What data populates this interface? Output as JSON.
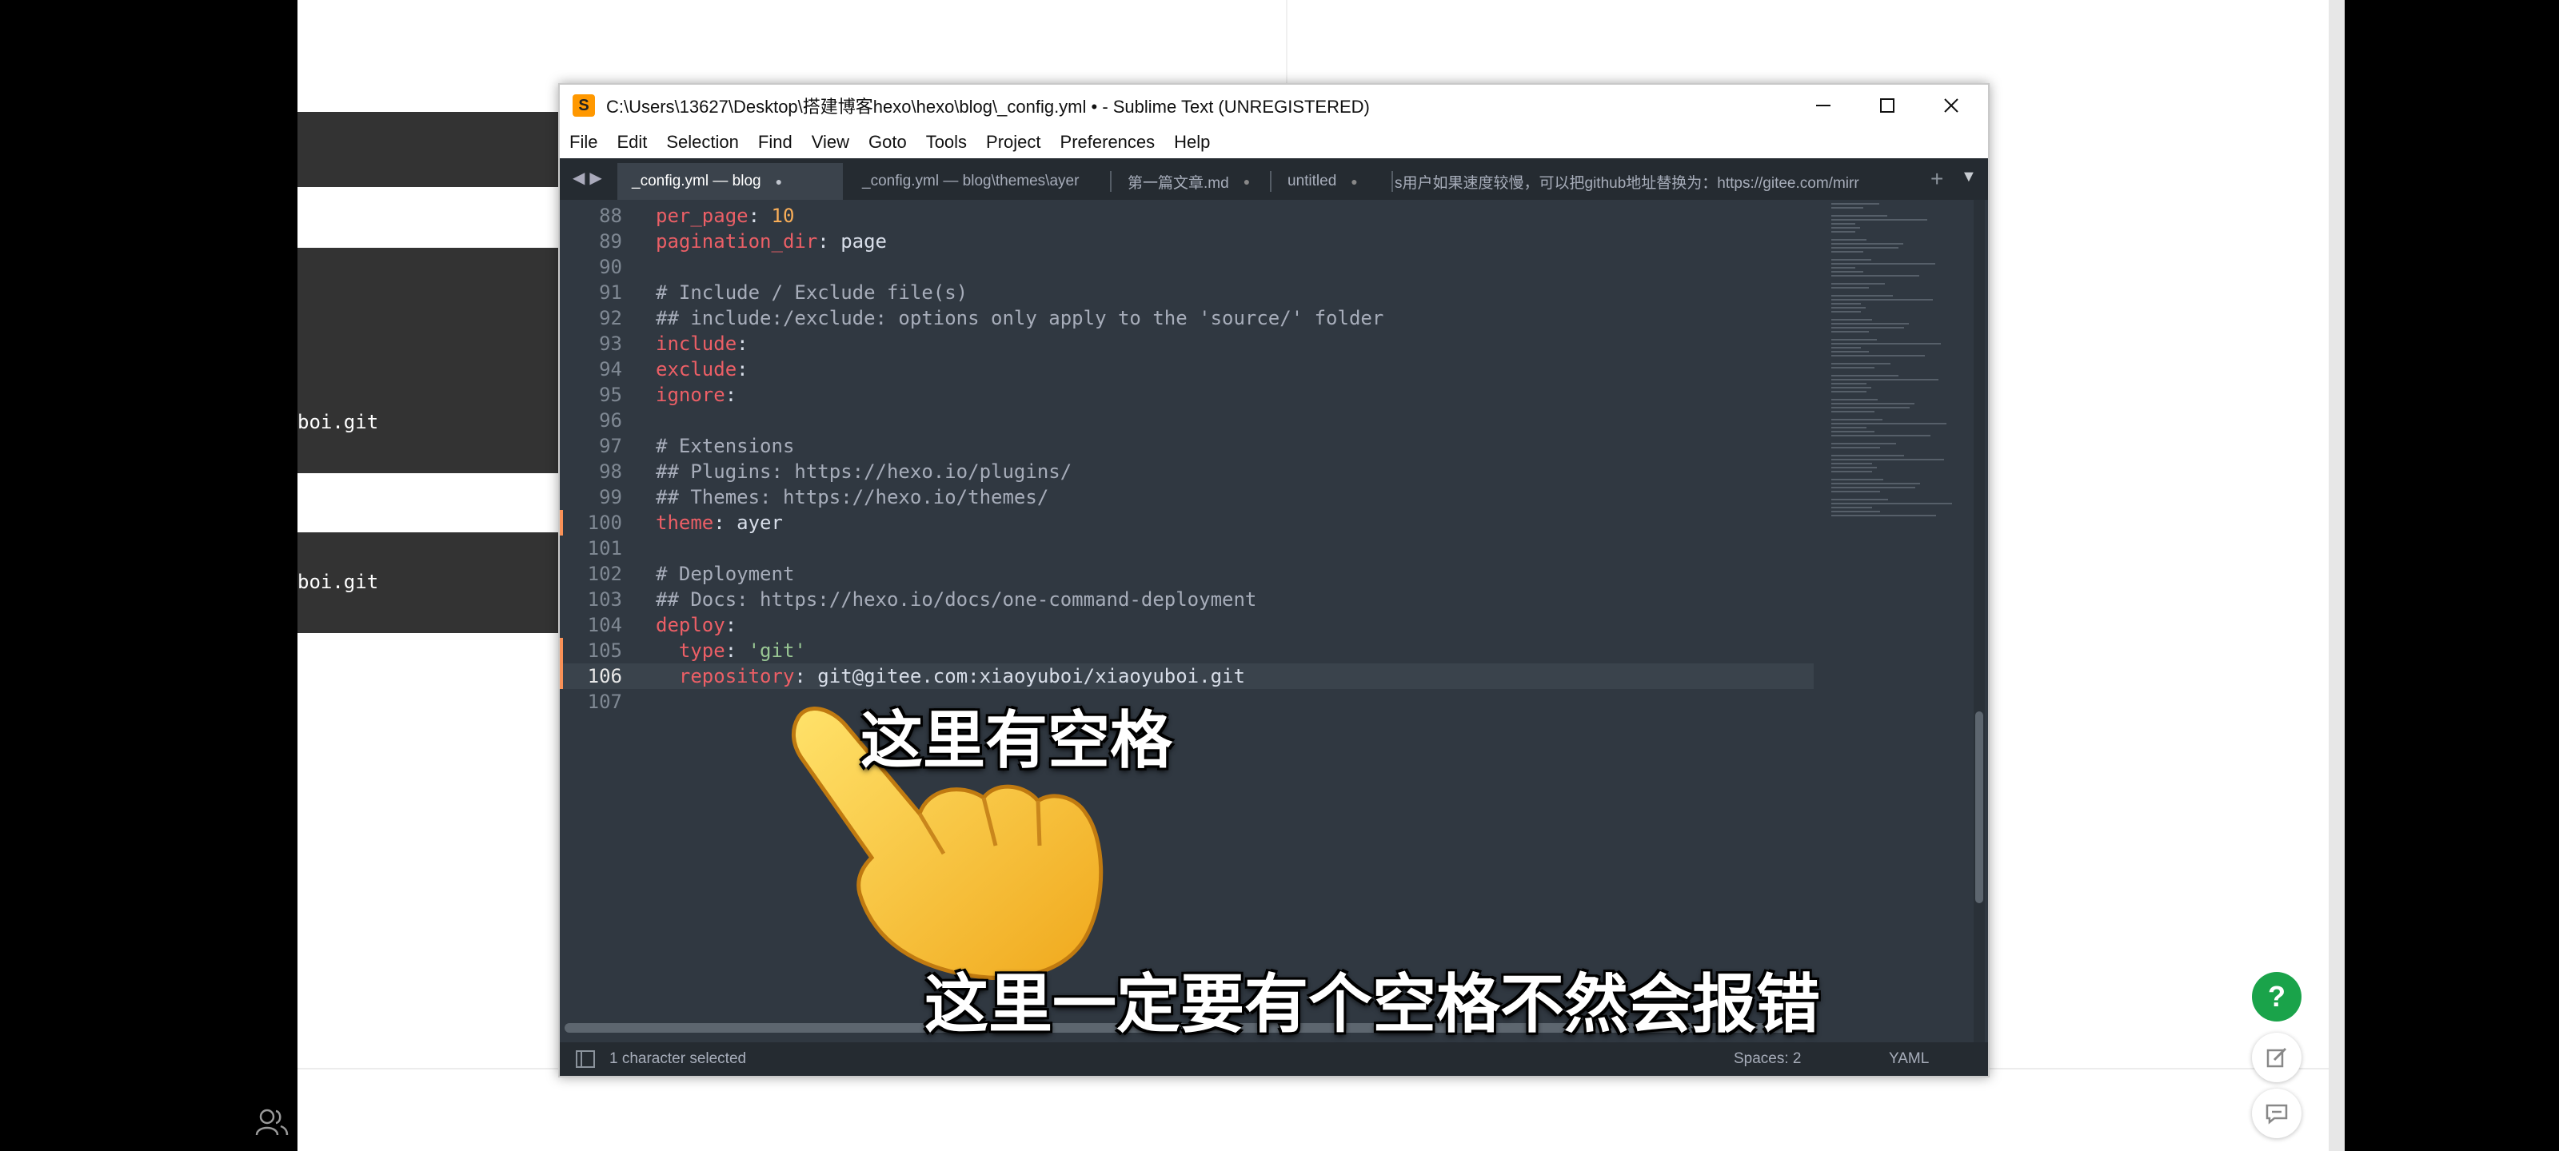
{
  "background": {
    "band_texts": [
      "boi.git",
      "boi.git"
    ]
  },
  "window": {
    "title": "C:\\Users\\13627\\Desktop\\搭建博客hexo\\hexo\\blog\\_config.yml • - Sublime Text (UNREGISTERED)",
    "app_icon": "S"
  },
  "menu": [
    "File",
    "Edit",
    "Selection",
    "Find",
    "View",
    "Goto",
    "Tools",
    "Project",
    "Preferences",
    "Help"
  ],
  "tabs": [
    {
      "label": "_config.yml — blog",
      "active": true
    },
    {
      "label": "_config.yml — blog\\themes\\ayer",
      "active": false
    },
    {
      "label": "第一篇文章.md",
      "active": false
    },
    {
      "label": "untitled",
      "active": false
    },
    {
      "label": "s用户如果速度较慢，可以把github地址替换为：https://gitee.com/mirr",
      "active": false
    }
  ],
  "tab_dirty_marker": "●",
  "editor": {
    "lines": [
      {
        "n": "88",
        "parts": [
          [
            "key",
            "per_page"
          ],
          [
            "plain",
            ": "
          ],
          [
            "num",
            "10"
          ]
        ]
      },
      {
        "n": "89",
        "parts": [
          [
            "key",
            "pagination_dir"
          ],
          [
            "plain",
            ": page"
          ]
        ]
      },
      {
        "n": "90",
        "parts": []
      },
      {
        "n": "91",
        "parts": [
          [
            "cm",
            "# Include / Exclude file(s)"
          ]
        ]
      },
      {
        "n": "92",
        "parts": [
          [
            "cm",
            "## include:/exclude: options only apply to the 'source/' folder"
          ]
        ]
      },
      {
        "n": "93",
        "parts": [
          [
            "key",
            "include"
          ],
          [
            "plain",
            ":"
          ]
        ]
      },
      {
        "n": "94",
        "parts": [
          [
            "key",
            "exclude"
          ],
          [
            "plain",
            ":"
          ]
        ]
      },
      {
        "n": "95",
        "parts": [
          [
            "key",
            "ignore"
          ],
          [
            "plain",
            ":"
          ]
        ]
      },
      {
        "n": "96",
        "parts": []
      },
      {
        "n": "97",
        "parts": [
          [
            "cm",
            "# Extensions"
          ]
        ]
      },
      {
        "n": "98",
        "parts": [
          [
            "cm",
            "## Plugins: https://hexo.io/plugins/"
          ]
        ]
      },
      {
        "n": "99",
        "parts": [
          [
            "cm",
            "## Themes: https://hexo.io/themes/"
          ]
        ]
      },
      {
        "n": "100",
        "parts": [
          [
            "key",
            "theme"
          ],
          [
            "plain",
            ": ayer"
          ]
        ]
      },
      {
        "n": "101",
        "parts": []
      },
      {
        "n": "102",
        "parts": [
          [
            "cm",
            "# Deployment"
          ]
        ]
      },
      {
        "n": "103",
        "parts": [
          [
            "cm",
            "## Docs: https://hexo.io/docs/one-command-deployment"
          ]
        ]
      },
      {
        "n": "104",
        "parts": [
          [
            "key",
            "deploy"
          ],
          [
            "plain",
            ":"
          ]
        ]
      },
      {
        "n": "105",
        "parts": [
          [
            "plain",
            "  "
          ],
          [
            "key",
            "type"
          ],
          [
            "plain",
            ": "
          ],
          [
            "str",
            "'git'"
          ]
        ]
      },
      {
        "n": "106",
        "parts": [
          [
            "plain",
            "  "
          ],
          [
            "key",
            "repository"
          ],
          [
            "plain",
            ": git@gitee.com:xiaoyuboi/xiaoyuboi.git"
          ]
        ]
      },
      {
        "n": "107",
        "parts": []
      }
    ],
    "current_line": "106",
    "modified_lines": [
      "100",
      "105",
      "106"
    ]
  },
  "status": {
    "left": "1 character selected",
    "spaces": "Spaces: 2",
    "syntax": "YAML"
  },
  "overlay": {
    "caption_top": "这里有空格",
    "caption_bottom": "这里一定要有个空格不然会报错",
    "hand_emoji": "pointing-hand"
  },
  "side_buttons": {
    "help_label": "?"
  },
  "colors": {
    "editor_bg": "#303841",
    "accent_orange": "#f9ae58",
    "help_green": "#1aa34a"
  }
}
